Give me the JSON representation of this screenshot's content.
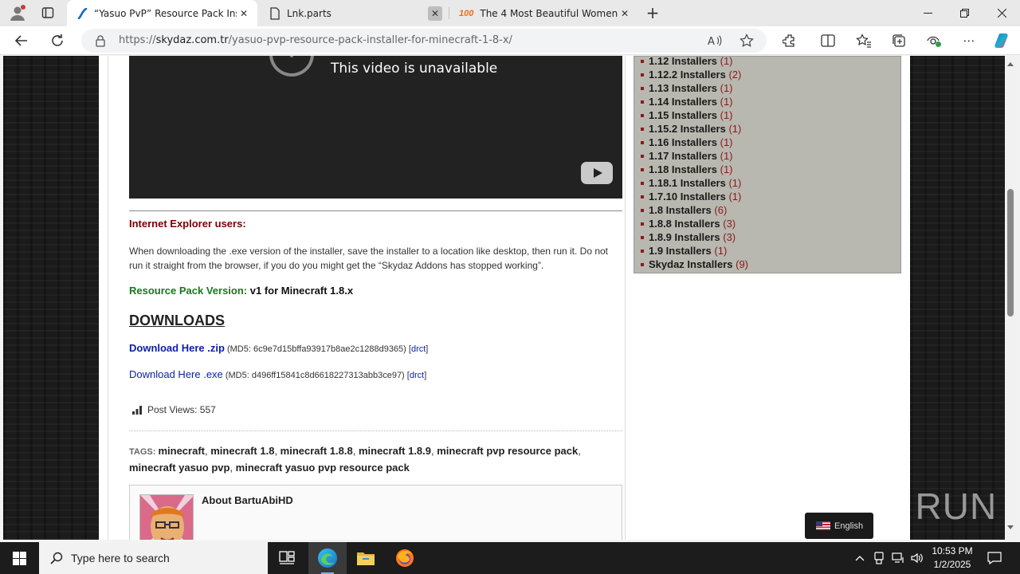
{
  "browser": {
    "tabs": [
      {
        "title": "“Yasuo PvP” Resource Pack Installer for Minecraft 1.8.x",
        "icon": "skydaz-logo-icon",
        "active": true
      },
      {
        "title": "Lnk.parts",
        "icon": "page-icon",
        "active": false
      },
      {
        "title": "The 4 Most Beautiful Women in the World",
        "icon": "site-100-icon",
        "active": false
      }
    ],
    "url_prefix": "https://",
    "url_host": "skydaz.com.tr",
    "url_path": "/yasuo-pvp-resource-pack-installer-for-minecraft-1-8-x/"
  },
  "video": {
    "message": "This video is unavailable"
  },
  "post": {
    "ie_title": "Internet Explorer users:",
    "ie_text": "When downloading the .exe version of the installer, save the installer to a location like desktop, then run it. Do not run it straight from the browser, if you do you might get the “Skydaz Addons has stopped working”.",
    "version_label": "Resource Pack Version:",
    "version_value": " v1 for Minecraft 1.8.x",
    "downloads_heading": "DOWNLOADS",
    "downloads": [
      {
        "label": "Download Here .zip",
        "md5": " (MD5: 6c9e7d15bffa93917b8ae2c1288d9365) [",
        "direct": "drct",
        "close": "]"
      },
      {
        "label": "Download Here .exe",
        "md5": " (MD5: d496ff15841c8d6618227313abb3ce97) [",
        "direct": "drct",
        "close": "]"
      }
    ],
    "views": "Post Views: 557",
    "tags_label": "TAGS: ",
    "tags": [
      "minecraft",
      "minecraft 1.8",
      "minecraft 1.8.8",
      "minecraft 1.8.9",
      "minecraft pvp resource pack",
      "minecraft yasuo pvp",
      "minecraft yasuo pvp resource pack"
    ],
    "author_title": "About BartuAbiHD"
  },
  "sidebar": {
    "categories": [
      {
        "name": "1.12 Installers",
        "count": "(1)"
      },
      {
        "name": "1.12.2 Installers",
        "count": "(2)"
      },
      {
        "name": "1.13 Installers",
        "count": "(1)"
      },
      {
        "name": "1.14 Installers",
        "count": "(1)"
      },
      {
        "name": "1.15 Installers",
        "count": "(1)"
      },
      {
        "name": "1.15.2 Installers",
        "count": "(1)"
      },
      {
        "name": "1.16 Installers",
        "count": "(1)"
      },
      {
        "name": "1.17 Installers",
        "count": "(1)"
      },
      {
        "name": "1.18 Installers",
        "count": "(1)"
      },
      {
        "name": "1.18.1 Installers",
        "count": "(1)"
      },
      {
        "name": "1.7.10 Installers",
        "count": "(1)"
      },
      {
        "name": "1.8 Installers",
        "count": "(6)"
      },
      {
        "name": "1.8.8 Installers",
        "count": "(3)"
      },
      {
        "name": "1.8.9 Installers",
        "count": "(3)"
      },
      {
        "name": "1.9 Installers",
        "count": "(1)"
      },
      {
        "name": "Skydaz Installers",
        "count": "(9)"
      }
    ]
  },
  "language": {
    "label": "English"
  },
  "watermark": "ANY RUN",
  "taskbar": {
    "search_placeholder": "Type here to search",
    "time": "10:53 PM",
    "date": "1/2/2025"
  }
}
